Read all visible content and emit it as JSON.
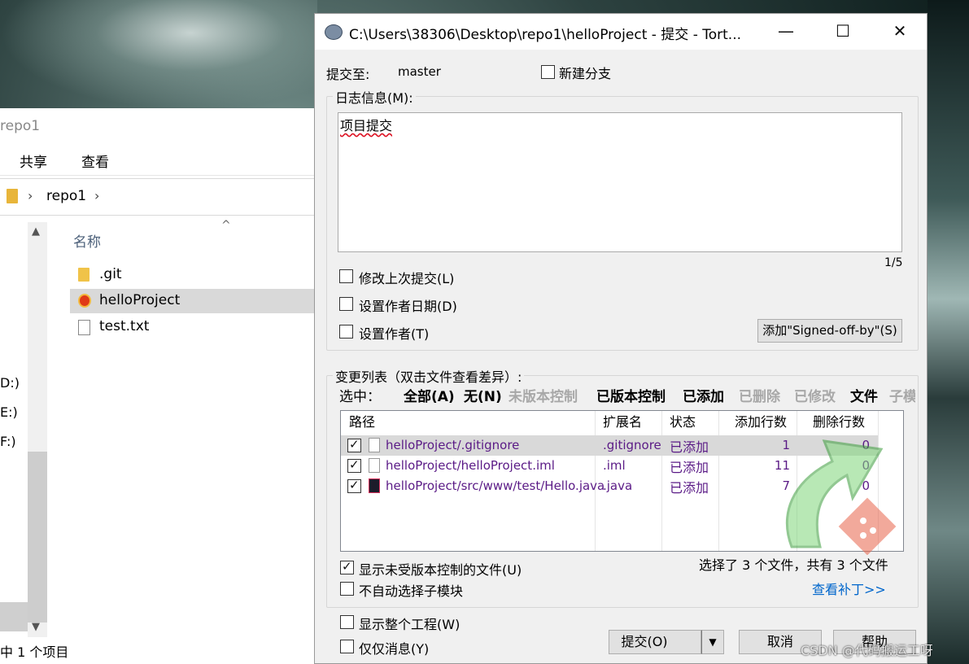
{
  "explorer": {
    "title": "repo1",
    "ribbon": [
      "共享",
      "查看"
    ],
    "breadcrumb": "repo1",
    "column_name": "名称",
    "files": [
      {
        "name": ".git",
        "icon": "folder-icon"
      },
      {
        "name": "helloProject",
        "icon": "tortoisegit-repo-icon",
        "selected": true
      },
      {
        "name": "test.txt",
        "icon": "text-file-icon"
      }
    ],
    "drives": [
      "D:)",
      "E:)",
      "F:)"
    ],
    "status": "中 1 个项目"
  },
  "dialog": {
    "title": "C:\\Users\\38306\\Desktop\\repo1\\helloProject - 提交 - Tort...",
    "commit_to_label": "提交至:",
    "branch": "master",
    "new_branch_label": "新建分支",
    "message_group_label": "日志信息(M):",
    "message": "项目提交",
    "line_counter": "1/5",
    "amend_label": "修改上次提交(L)",
    "set_author_date_label": "设置作者日期(D)",
    "set_author_label": "设置作者(T)",
    "signed_off_button": "添加\"Signed-off-by\"(S)",
    "changes_group_label": "变更列表（双击文件查看差异）:",
    "select_label": "选中：",
    "filters": {
      "all": "全部(A)",
      "none": "无(N)",
      "unversioned": "未版本控制",
      "versioned": "已版本控制",
      "added": "已添加",
      "deleted": "已删除",
      "modified": "已修改",
      "files": "文件",
      "submodules": "子模块"
    },
    "columns": [
      "路径",
      "扩展名",
      "状态",
      "添加行数",
      "删除行数"
    ],
    "rows": [
      {
        "path": "helloProject/.gitignore",
        "ext": ".gitignore",
        "status": "已添加",
        "added": "1",
        "deleted": "0",
        "checked": true
      },
      {
        "path": "helloProject/helloProject.iml",
        "ext": ".iml",
        "status": "已添加",
        "added": "11",
        "deleted": "0",
        "checked": true
      },
      {
        "path": "helloProject/src/www/test/Hello.java",
        "ext": ".java",
        "status": "已添加",
        "added": "7",
        "deleted": "0",
        "checked": true
      }
    ],
    "show_unversioned_label": "显示未受版本控制的文件(U)",
    "no_auto_submodule_label": "不自动选择子模块",
    "selection_summary": "选择了 3 个文件，共有 3 个文件",
    "view_patch_link": "查看补丁>>",
    "show_whole_project_label": "显示整个工程(W)",
    "message_only_label": "仅仅消息(Y)",
    "commit_button": "提交(O)",
    "cancel_button": "取消",
    "help_button": "帮助"
  },
  "watermark": "CSDN @代码搬运工呀"
}
